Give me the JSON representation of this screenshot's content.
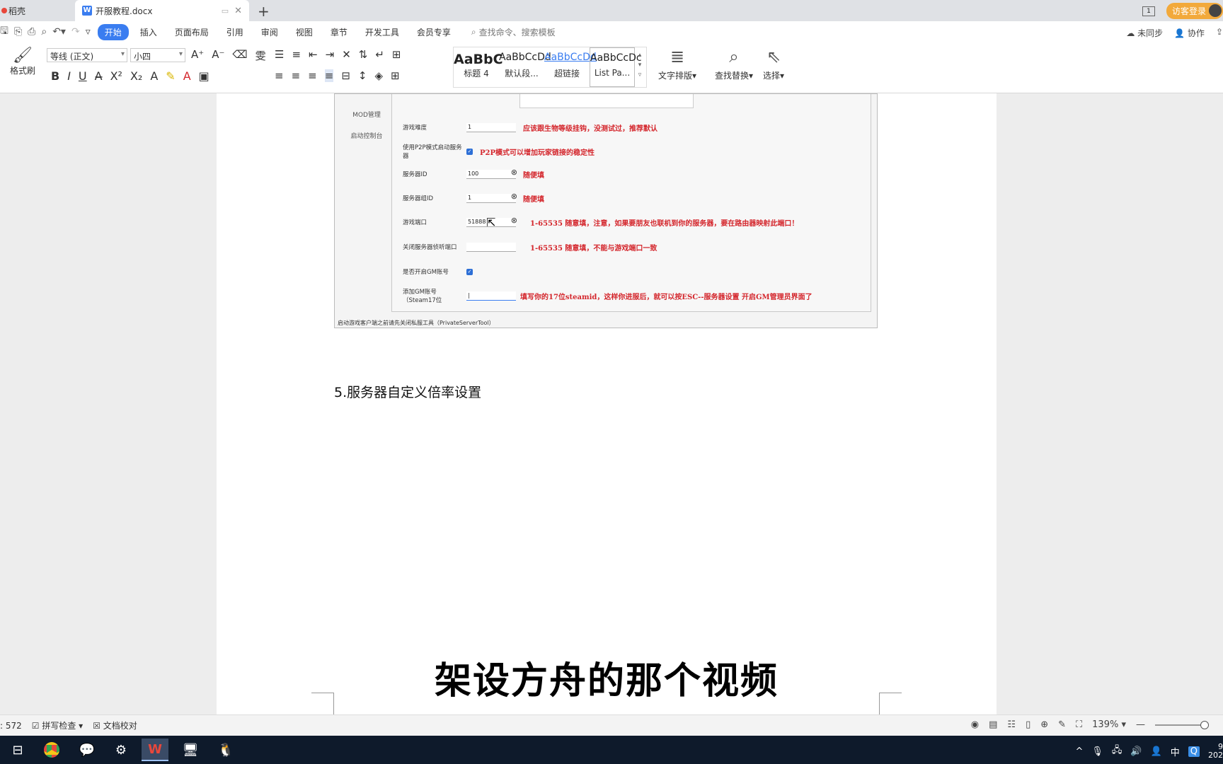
{
  "tabs": [
    {
      "label": "稻壳"
    },
    {
      "label": "开服教程.docx"
    }
  ],
  "titlebar": {
    "login_label": "访客登录",
    "page_indicator": "1"
  },
  "menubar": {
    "items": [
      "开始",
      "插入",
      "页面布局",
      "引用",
      "审阅",
      "视图",
      "章节",
      "开发工具",
      "会员专享"
    ],
    "search_placeholder": "查找命令、搜索模板",
    "sync_label": "未同步",
    "collab_label": "协作"
  },
  "ribbon": {
    "format_brush": "格式刷",
    "font_name": "等线 (正文)",
    "font_size": "小四",
    "styles": [
      {
        "sample": "AaBbC",
        "label": "标题 4"
      },
      {
        "sample": "AaBbCcDd",
        "label": "默认段..."
      },
      {
        "sample": "AaBbCcDd",
        "label": "超链接"
      },
      {
        "sample": "AaBbCcDc",
        "label": "List Pa..."
      }
    ],
    "text_layout": "文字排版",
    "find_replace": "查找替换",
    "select": "选择"
  },
  "embed": {
    "sidebar": [
      "MOD管理",
      "启动控制台"
    ],
    "rows": [
      {
        "label": "游戏难度",
        "value": "1",
        "note": "应该跟生物等级挂钩，没测试过，推荐默认"
      },
      {
        "label": "使用P2P模式启动服务器",
        "note": "P2P模式可以增加玩家链接的稳定性"
      },
      {
        "label": "服务器ID",
        "value": "100",
        "note": "随便填"
      },
      {
        "label": "服务器组ID",
        "value": "1",
        "note": "随便填"
      },
      {
        "label": "游戏端口",
        "value": "51888",
        "note": "1-65535 随意填，注意，如果要朋友也联机到你的服务器，要在路由器映射此端口！"
      },
      {
        "label": "关闭服务器侦听端口",
        "value": "",
        "note": "1-65535 随意填，不能与游戏端口一致"
      },
      {
        "label": "是否开启GM账号"
      },
      {
        "label": "添加GM账号（Steam17位",
        "value": "|",
        "note": "填写你的17位steamid，这样你进服后，就可以按ESC--服务器设置 开启GM管理员界面了"
      }
    ],
    "footer": "启动游戏客户端之前请先关闭私服工具（PrivateServerTool）"
  },
  "doc": {
    "heading": "5.服务器自定义倍率设置",
    "subtitle": "架设方舟的那个视频"
  },
  "statusbar": {
    "word_count": ": 572",
    "spell_check": "拼写检查",
    "doc_check": "文档校对",
    "zoom": "139%"
  },
  "taskbar": {
    "ime": "中",
    "clock_time": "9",
    "clock_date": "202"
  }
}
